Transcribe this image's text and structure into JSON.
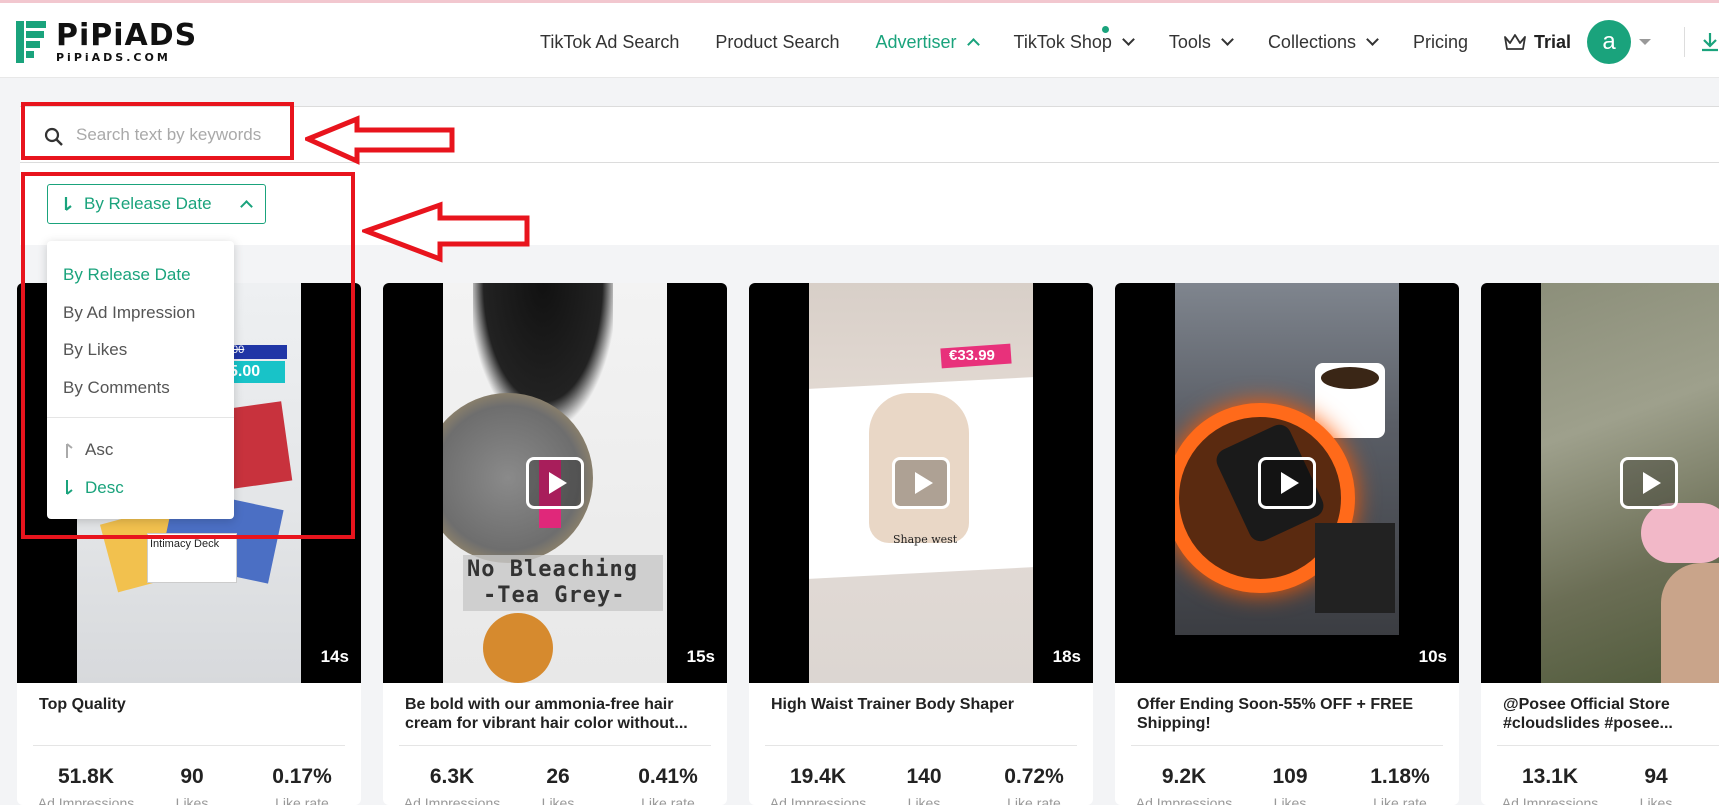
{
  "brand": {
    "name": "PiPiADS",
    "domain": "PiPiADS.COM",
    "accent": "#1aa37c"
  },
  "nav": {
    "items": [
      {
        "label": "TikTok Ad Search"
      },
      {
        "label": "Product Search"
      },
      {
        "label": "Advertiser",
        "active": true
      },
      {
        "label": "TikTok Shop"
      },
      {
        "label": "Tools"
      },
      {
        "label": "Collections"
      },
      {
        "label": "Pricing"
      }
    ],
    "trial_label": "Trial",
    "avatar_letter": "a"
  },
  "search": {
    "placeholder": "Search text by keywords",
    "value": ""
  },
  "sort": {
    "selected": "By Release Date",
    "options": [
      "By Release Date",
      "By Ad Impression",
      "By Likes",
      "By Comments"
    ],
    "order_options": [
      "Asc",
      "Desc"
    ],
    "order_selected": "Desc"
  },
  "cards": [
    {
      "title": "Top Quality",
      "duration": "14s",
      "impressions": "51.8K",
      "likes": "90",
      "like_rate": "0.17%",
      "overlay": ".00",
      "overlay2": "5.00",
      "caption": "Intimacy Deck"
    },
    {
      "title": "Be bold with our ammonia-free hair cream for vibrant hair color without...",
      "duration": "15s",
      "impressions": "6.3K",
      "likes": "26",
      "like_rate": "0.41%",
      "overlay": "No Bleaching",
      "overlay2": "-Tea Grey-"
    },
    {
      "title": "High Waist Trainer Body Shaper",
      "duration": "18s",
      "impressions": "19.4K",
      "likes": "140",
      "like_rate": "0.72%",
      "overlay": "€33.99",
      "caption": "Shape west"
    },
    {
      "title": "Offer Ending Soon-55% OFF + FREE Shipping!",
      "duration": "10s",
      "impressions": "9.2K",
      "likes": "109",
      "like_rate": "1.18%"
    },
    {
      "title": "@Posee Official Store #cloudslides #posee...",
      "duration": "",
      "impressions": "13.1K",
      "likes": "94",
      "like_rate": ""
    }
  ],
  "stat_labels": {
    "impressions": "Ad Impressions",
    "likes": "Likes",
    "like_rate": "Like rate"
  }
}
